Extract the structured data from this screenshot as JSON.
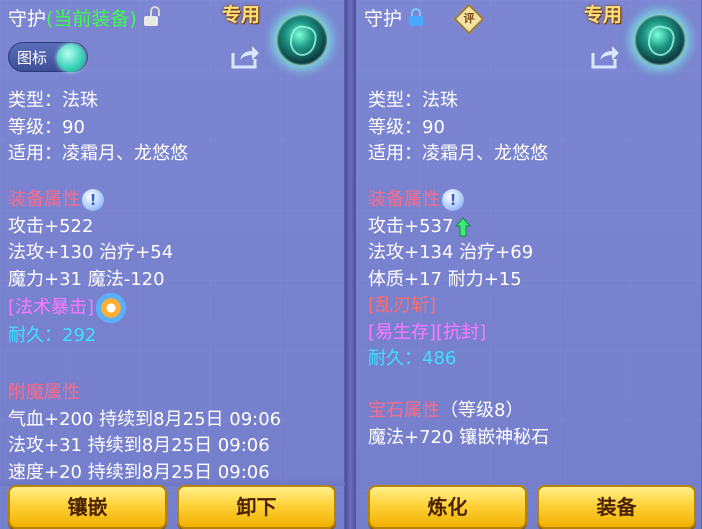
{
  "left": {
    "title_prefix": "守护",
    "title_suffix": "(当前装备)",
    "exclusive_label": "专用",
    "icon_toggle_label": "图标",
    "type_line": "类型：法珠",
    "level_line": "等级：90",
    "applies_line": "适用：凌霜月、龙悠悠",
    "equip_attr_title": "装备属性",
    "attr_lines": [
      "攻击+522",
      "法攻+130 治疗+54",
      "魔力+31 魔法-120"
    ],
    "special_skill": "[法术暴击]",
    "durability_label": "耐久：",
    "durability_value": "292",
    "enchant_title": "附魔属性",
    "enchant_lines": [
      "气血+200 持续到8月25日 09:06",
      "法攻+31 持续到8月25日 09:06",
      "速度+20 持续到8月25日 09:06"
    ],
    "buttons": [
      "镶嵌",
      "卸下"
    ]
  },
  "right": {
    "title_prefix": "守护",
    "appraise_label": "评",
    "exclusive_label": "专用",
    "type_line": "类型：法珠",
    "level_line": "等级：90",
    "applies_line": "适用：凌霜月、龙悠悠",
    "equip_attr_title": "装备属性",
    "attr_lines": [
      "攻击+537",
      "法攻+134 治疗+69",
      "体质+17 耐力+15"
    ],
    "skill_red": "[乱刃斩]",
    "special_skills": "[易生存][抗封]",
    "durability_label": "耐久：",
    "durability_value": "486",
    "gem_title": "宝石属性",
    "gem_level": "（等级8）",
    "gem_line": "魔法+720 镶嵌神秘石",
    "buttons": [
      "炼化",
      "装备"
    ]
  },
  "colors": {
    "accent_green": "#3aff4a",
    "section_pink": "#ff6a8a",
    "cyan": "#3ee0ff",
    "magenta": "#ff78ff",
    "button_gold": "#ffd23a"
  },
  "icons": [
    "lock-open-icon",
    "lock-icon",
    "share-icon",
    "info-icon",
    "swirl-skill-icon",
    "up-arrow-icon",
    "appraise-icon",
    "equipment-orb-icon"
  ]
}
